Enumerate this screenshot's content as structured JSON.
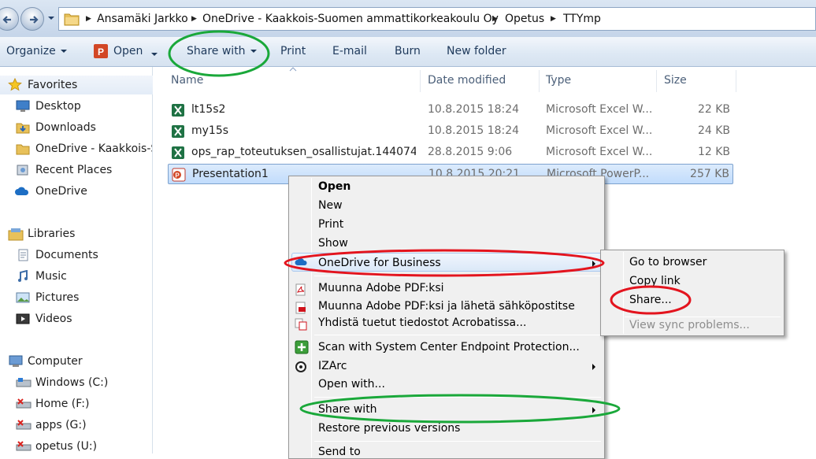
{
  "address_bar": {
    "breadcrumbs": [
      "Ansamäki Jarkko",
      "OneDrive - Kaakkois-Suomen ammattikorkeakoulu Oy",
      "Opetus",
      "TTYmp"
    ]
  },
  "toolbar": {
    "organize": "Organize",
    "open": "Open",
    "share_with": "Share with",
    "print": "Print",
    "email": "E-mail",
    "burn": "Burn",
    "new_folder": "New folder"
  },
  "nav_pane": {
    "favorites": {
      "label": "Favorites",
      "items": [
        "Desktop",
        "Downloads",
        "OneDrive - Kaakkois-S",
        "Recent Places",
        "OneDrive"
      ]
    },
    "libraries": {
      "label": "Libraries",
      "items": [
        "Documents",
        "Music",
        "Pictures",
        "Videos"
      ]
    },
    "computer": {
      "label": "Computer",
      "items": [
        "Windows (C:)",
        "Home (F:)",
        "apps (G:)",
        "opetus (U:)"
      ]
    }
  },
  "file_list": {
    "columns": [
      "Name",
      "Date modified",
      "Type",
      "Size"
    ],
    "rows": [
      {
        "name": "lt15s2",
        "date": "10.8.2015 18:24",
        "type": "Microsoft Excel W...",
        "size": "22 KB",
        "icon": "excel-icon"
      },
      {
        "name": "my15s",
        "date": "10.8.2015 18:24",
        "type": "Microsoft Excel W...",
        "size": "24 KB",
        "icon": "excel-icon"
      },
      {
        "name": "ops_rap_toteutuksen_osallistujat.1440741...",
        "date": "28.8.2015 9:06",
        "type": "Microsoft Excel W...",
        "size": "12 KB",
        "icon": "excel-icon"
      },
      {
        "name": "Presentation1",
        "date": "10.8.2015 20:21",
        "type": "Microsoft PowerP...",
        "size": "257 KB",
        "icon": "powerpoint-icon"
      }
    ]
  },
  "context_menu": {
    "open": "Open",
    "new": "New",
    "print": "Print",
    "show": "Show",
    "onedrive_business": "OneDrive for Business",
    "adobe_pdf": "Muunna Adobe PDF:ksi",
    "adobe_pdf_email": "Muunna Adobe PDF:ksi ja lähetä sähköpostitse",
    "acrobat_combine": "Yhdistä tuetut tiedostot Acrobatissa...",
    "scan": "Scan with System Center Endpoint Protection...",
    "izarc": "IZArc",
    "open_with": "Open with...",
    "share_with": "Share with",
    "restore": "Restore previous versions",
    "send_to": "Send to"
  },
  "submenu": {
    "go_to_browser": "Go to browser",
    "copy_link": "Copy link",
    "share": "Share...",
    "view_sync": "View sync problems..."
  },
  "colors": {
    "annotation_green": "#1aa83a",
    "annotation_red": "#e3141e",
    "selection": "#c1dcfc",
    "toolbar_text": "#1e395b"
  }
}
